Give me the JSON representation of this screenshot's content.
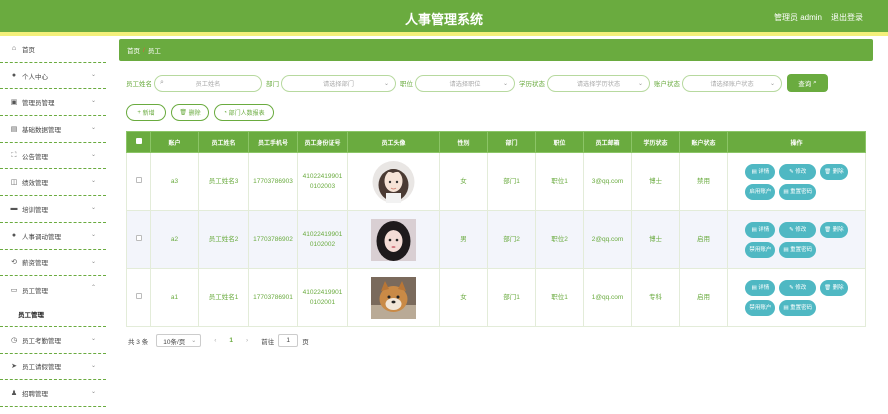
{
  "header": {
    "title": "人事管理系统",
    "admin": "管理员 admin",
    "logout": "退出登录"
  },
  "sidebar": {
    "items": [
      {
        "label": "首页",
        "icon": "home-icon"
      },
      {
        "label": "个人中心",
        "icon": "user-icon"
      },
      {
        "label": "管理员管理",
        "icon": "admin-icon"
      },
      {
        "label": "基础数据管理",
        "icon": "database-icon"
      },
      {
        "label": "公告管理",
        "icon": "notice-icon"
      },
      {
        "label": "绩效管理",
        "icon": "chart-icon"
      },
      {
        "label": "培训管理",
        "icon": "monitor-icon"
      },
      {
        "label": "人事调动管理",
        "icon": "person-icon"
      },
      {
        "label": "薪资管理",
        "icon": "money-icon"
      },
      {
        "label": "员工管理",
        "icon": "employee-icon"
      }
    ],
    "sub_item": "员工管理",
    "items_after": [
      {
        "label": "员工考勤管理",
        "icon": "clock-icon"
      },
      {
        "label": "员工请假管理",
        "icon": "send-icon"
      },
      {
        "label": "招聘管理",
        "icon": "recruit-icon"
      }
    ]
  },
  "breadcrumb": {
    "home": "首页",
    "sep": "/",
    "current": "员工"
  },
  "search": {
    "name_label": "员工姓名",
    "name_placeholder": "员工姓名",
    "dept_label": "部门",
    "dept_placeholder": "请选择部门",
    "pos_label": "职位",
    "pos_placeholder": "请选择职位",
    "edu_label": "学历状态",
    "edu_placeholder": "请选择学历状态",
    "acct_label": "账户状态",
    "acct_placeholder": "请选择账户状态",
    "query": "查询"
  },
  "actions": {
    "add": "新增",
    "delete": "删除",
    "report": "部门人数报表"
  },
  "table": {
    "headers": [
      "账户",
      "员工姓名",
      "员工手机号",
      "员工身份证号",
      "员工头像",
      "性别",
      "部门",
      "职位",
      "员工邮箱",
      "学历状态",
      "账户状态",
      "操作"
    ],
    "rows": [
      {
        "account": "a3",
        "name": "员工姓名3",
        "phone": "17703786903",
        "idcard": "410224199010102003",
        "avatar": "girl-illustration",
        "gender": "女",
        "dept": "部门1",
        "position": "职位1",
        "email": "3@qq.com",
        "edu": "博士",
        "status": "禁用",
        "toggle": "启用账户"
      },
      {
        "account": "a2",
        "name": "员工姓名2",
        "phone": "17703786902",
        "idcard": "410224199010102002",
        "avatar": "girl-photo",
        "gender": "男",
        "dept": "部门2",
        "position": "职位2",
        "email": "2@qq.com",
        "edu": "博士",
        "status": "启用",
        "toggle": "禁用账户"
      },
      {
        "account": "a1",
        "name": "员工姓名1",
        "phone": "17703786901",
        "idcard": "410224199010102001",
        "avatar": "dog-photo",
        "gender": "女",
        "dept": "部门1",
        "position": "职位1",
        "email": "1@qq.com",
        "edu": "专科",
        "status": "启用",
        "toggle": "禁用账户"
      }
    ],
    "op_labels": {
      "detail": "详情",
      "edit": "修改",
      "delete": "删除",
      "reset": "重置密码"
    }
  },
  "pager": {
    "total": "共 3 条",
    "size": "10条/页",
    "current": "1",
    "goto": "前往",
    "page_value": "1",
    "page_suffix": "页"
  },
  "colors": {
    "accent": "#6aab3f",
    "stripe": "#f3f07a",
    "op_button": "#4fb8c3"
  }
}
